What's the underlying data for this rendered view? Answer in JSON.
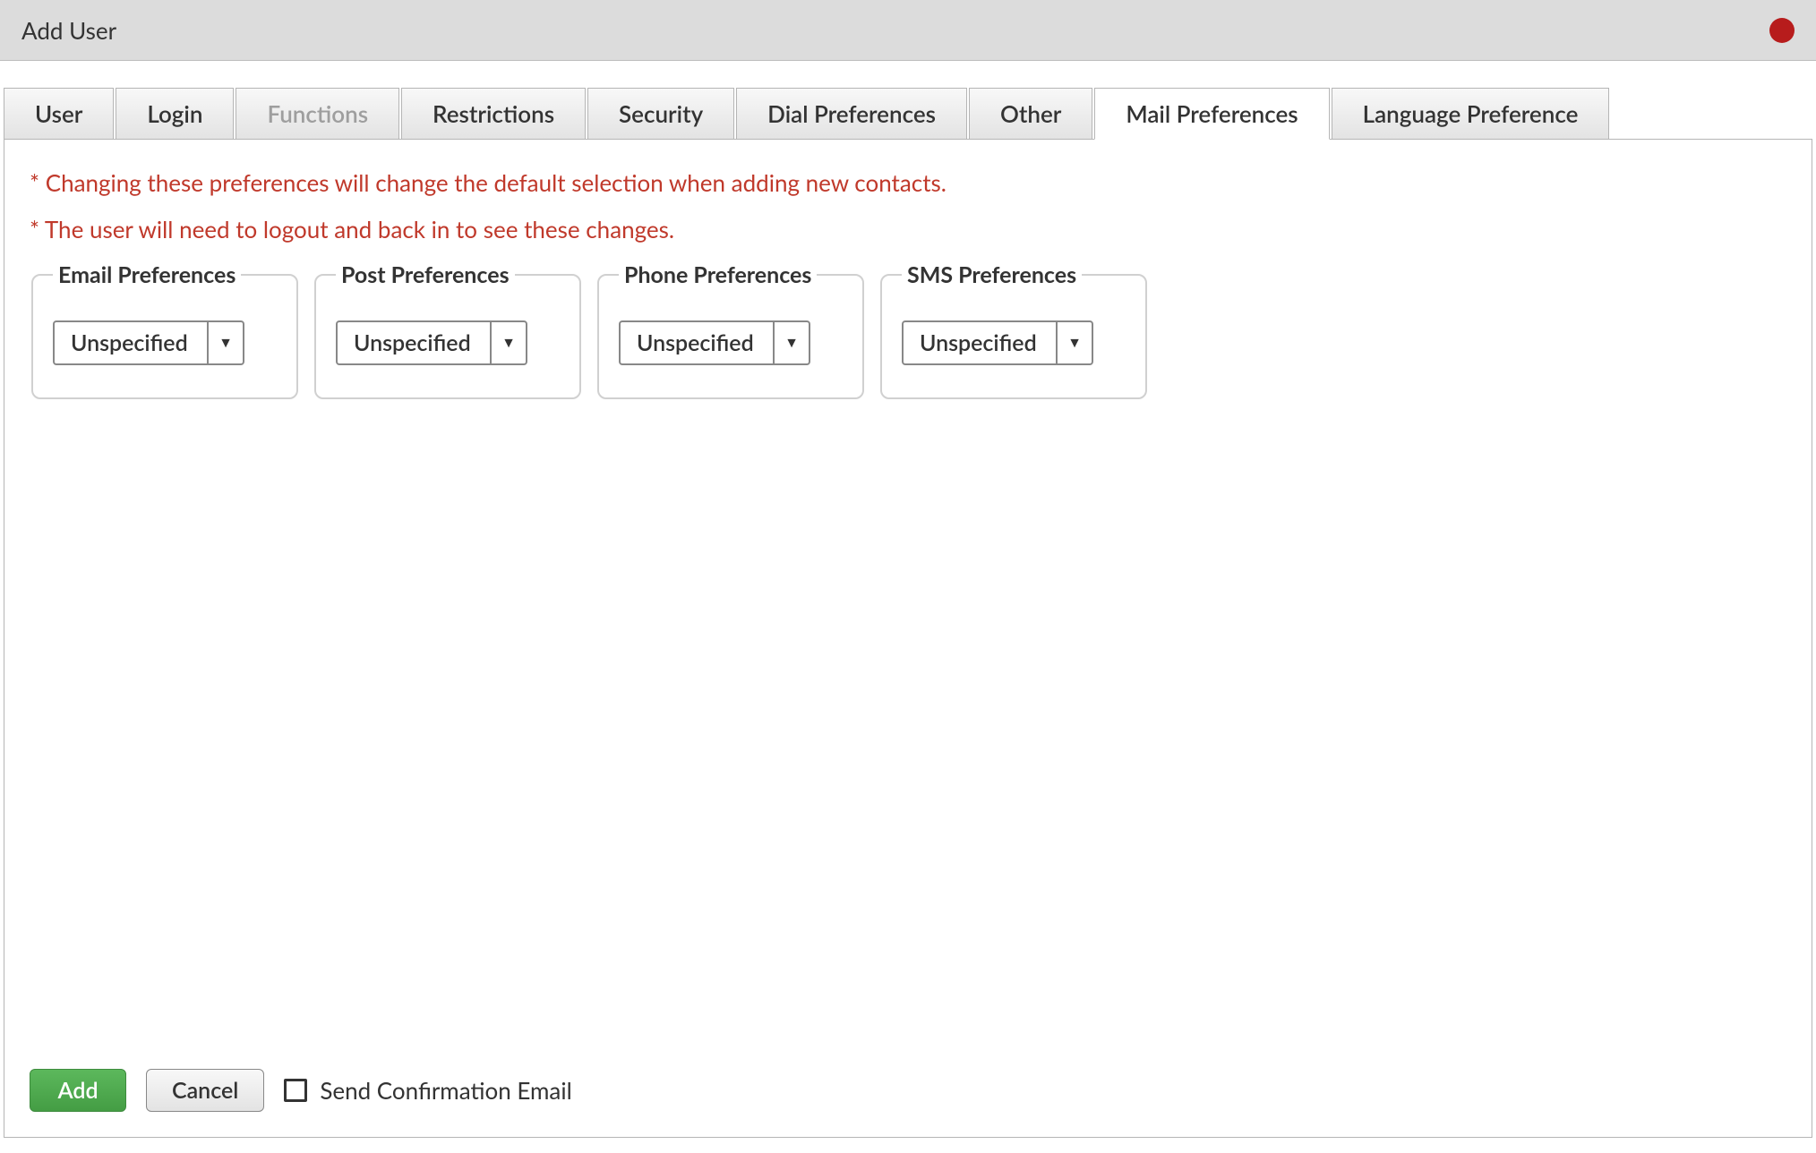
{
  "window": {
    "title": "Add User"
  },
  "tabs": [
    {
      "label": "User",
      "active": false,
      "disabled": false
    },
    {
      "label": "Login",
      "active": false,
      "disabled": false
    },
    {
      "label": "Functions",
      "active": false,
      "disabled": true
    },
    {
      "label": "Restrictions",
      "active": false,
      "disabled": false
    },
    {
      "label": "Security",
      "active": false,
      "disabled": false
    },
    {
      "label": "Dial Preferences",
      "active": false,
      "disabled": false
    },
    {
      "label": "Other",
      "active": false,
      "disabled": false
    },
    {
      "label": "Mail Preferences",
      "active": true,
      "disabled": false
    },
    {
      "label": "Language Preference",
      "active": false,
      "disabled": false
    }
  ],
  "notices": [
    "* Changing these preferences will change the default selection when adding new contacts.",
    "* The user will need to logout and back in to see these changes."
  ],
  "prefs": {
    "email": {
      "legend": "Email Preferences",
      "value": "Unspecified"
    },
    "post": {
      "legend": "Post Preferences",
      "value": "Unspecified"
    },
    "phone": {
      "legend": "Phone Preferences",
      "value": "Unspecified"
    },
    "sms": {
      "legend": "SMS Preferences",
      "value": "Unspecified"
    }
  },
  "footer": {
    "add": "Add",
    "cancel": "Cancel",
    "confirm_label": "Send Confirmation Email",
    "confirm_checked": false
  }
}
